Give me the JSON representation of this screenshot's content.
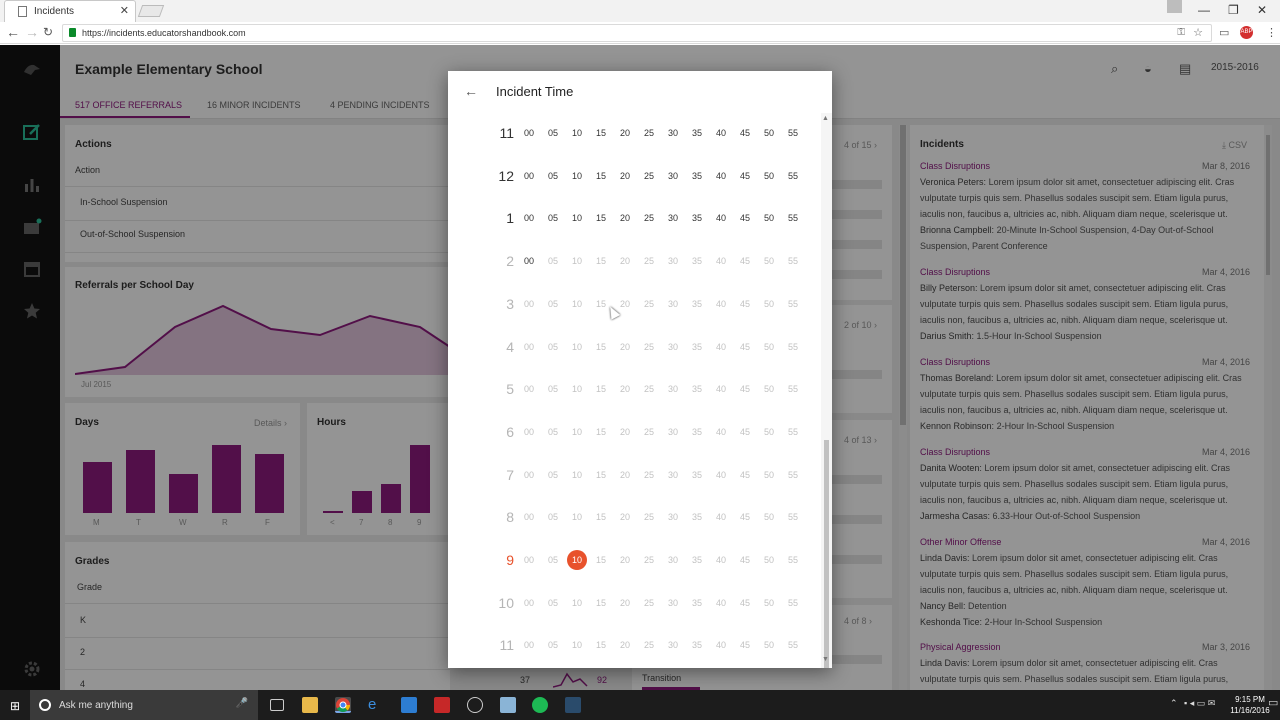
{
  "browser": {
    "tab_title": "Incidents",
    "url": "https://incidents.educatorshandbook.com"
  },
  "app": {
    "school_name": "Example Elementary School",
    "year": "2015-2016",
    "tabs": [
      {
        "label": "517 OFFICE REFERRALS",
        "active": true
      },
      {
        "label": "16 MINOR INCIDENTS",
        "active": false
      },
      {
        "label": "4 PENDING INCIDENTS",
        "active": false
      }
    ],
    "actions": {
      "title": "Actions",
      "column": "Action",
      "rows": [
        "In-School Suspension",
        "Out-of-School Suspension"
      ]
    },
    "referrals": {
      "title": "Referrals per School Day",
      "start_label": "Jul 2015"
    },
    "days": {
      "title": "Days",
      "details": "Details",
      "labels": [
        "M",
        "T",
        "W",
        "R",
        "F"
      ],
      "values": [
        51,
        63,
        39,
        68,
        59
      ]
    },
    "hours": {
      "title": "Hours",
      "labels": [
        "<",
        "7",
        "8",
        "9"
      ],
      "values": [
        2,
        22,
        29,
        68
      ]
    },
    "grades": {
      "title": "Grades",
      "column": "Grade",
      "rows": [
        "K",
        "2",
        "4"
      ]
    },
    "middle": {
      "pagers": [
        "4 of 15",
        "2 of 10",
        "4 of 13",
        "4 of 8"
      ],
      "transition_label": "Transition",
      "sparkline_left": "37",
      "sparkline_right": "92"
    },
    "incidents": {
      "title": "Incidents",
      "csv_label": "CSV",
      "items": [
        {
          "category": "Class Disruptions",
          "date": "Mar 8, 2016",
          "lines": [
            {
              "name": "Veronica Peters:",
              "text": "Lorem ipsum dolor sit amet, consectetuer adipiscing elit. Cras vulputate turpis quis sem. Phasellus sodales suscipit sem. Etiam ligula purus, iaculis non, faucibus a, ultricies ac, nibh. Aliquam diam neque, scelerisque ut."
            },
            {
              "name": "Brionna Campbell:",
              "text": "20-Minute In-School Suspension, 4-Day Out-of-School Suspension, Parent Conference"
            }
          ]
        },
        {
          "category": "Class Disruptions",
          "date": "Mar 4, 2016",
          "lines": [
            {
              "name": "Billy Peterson:",
              "text": "Lorem ipsum dolor sit amet, consectetuer adipiscing elit. Cras vulputate turpis quis sem. Phasellus sodales suscipit sem. Etiam ligula purus, iaculis non, faucibus a, ultricies ac, nibh. Aliquam diam neque, scelerisque ut."
            },
            {
              "name": "Darius Smith:",
              "text": "1.5-Hour In-School Suspension"
            }
          ]
        },
        {
          "category": "Class Disruptions",
          "date": "Mar 4, 2016",
          "lines": [
            {
              "name": "Thomas Boreland:",
              "text": "Lorem ipsum dolor sit amet, consectetuer adipiscing elit. Cras vulputate turpis quis sem. Phasellus sodales suscipit sem. Etiam ligula purus, iaculis non, faucibus a, ultricies ac, nibh. Aliquam diam neque, scelerisque ut."
            },
            {
              "name": "Kennon Robinson:",
              "text": "2-Hour In-School Suspension"
            }
          ]
        },
        {
          "category": "Class Disruptions",
          "date": "Mar 4, 2016",
          "lines": [
            {
              "name": "Danita Wooten:",
              "text": "Lorem ipsum dolor sit amet, consectetuer adipiscing elit. Cras vulputate turpis quis sem. Phasellus sodales suscipit sem. Etiam ligula purus, iaculis non, faucibus a, ultricies ac, nibh. Aliquam diam neque, scelerisque ut."
            },
            {
              "name": "Jarmesha Casas:",
              "text": "6.33-Hour Out-of-School Suspension"
            }
          ]
        },
        {
          "category": "Other Minor Offense",
          "date": "Mar 4, 2016",
          "lines": [
            {
              "name": "Linda Davis:",
              "text": "Lorem ipsum dolor sit amet, consectetuer adipiscing elit. Cras vulputate turpis quis sem. Phasellus sodales suscipit sem. Etiam ligula purus, iaculis non, faucibus a, ultricies ac, nibh. Aliquam diam neque, scelerisque ut."
            },
            {
              "name": "Nancy Bell:",
              "text": "Detention"
            },
            {
              "name": "Keshonda Tice:",
              "text": "2-Hour In-School Suspension"
            }
          ]
        },
        {
          "category": "Physical Aggression",
          "date": "Mar 3, 2016",
          "lines": [
            {
              "name": "Linda Davis:",
              "text": "Lorem ipsum dolor sit amet, consectetuer adipiscing elit. Cras vulputate turpis quis sem. Phasellus sodales suscipit sem. Etiam ligula purus,"
            }
          ]
        }
      ]
    }
  },
  "dialog": {
    "title": "Incident Time",
    "minutes": [
      "00",
      "05",
      "10",
      "15",
      "20",
      "25",
      "30",
      "35",
      "40",
      "45",
      "50",
      "55"
    ],
    "hours": [
      {
        "hour": "11",
        "enabled": true
      },
      {
        "hour": "12",
        "enabled": true
      },
      {
        "hour": "1",
        "enabled": true
      },
      {
        "hour": "2",
        "enabled": false,
        "enabled_minutes": [
          "00"
        ]
      },
      {
        "hour": "3",
        "enabled": false
      },
      {
        "hour": "4",
        "enabled": false
      },
      {
        "hour": "5",
        "enabled": false
      },
      {
        "hour": "6",
        "enabled": false
      },
      {
        "hour": "7",
        "enabled": false
      },
      {
        "hour": "8",
        "enabled": false
      },
      {
        "hour": "9",
        "enabled": false,
        "selected": true,
        "selected_minute": "10"
      },
      {
        "hour": "10",
        "enabled": false
      },
      {
        "hour": "11",
        "enabled": false
      }
    ]
  },
  "taskbar": {
    "search_placeholder": "Ask me anything",
    "time": "9:15 PM",
    "date": "11/16/2016"
  },
  "colors": {
    "brand": "#8e1a7e",
    "accent": "#e8522c",
    "sidebar": "#141414",
    "taskbar": "#1c1c1c"
  }
}
